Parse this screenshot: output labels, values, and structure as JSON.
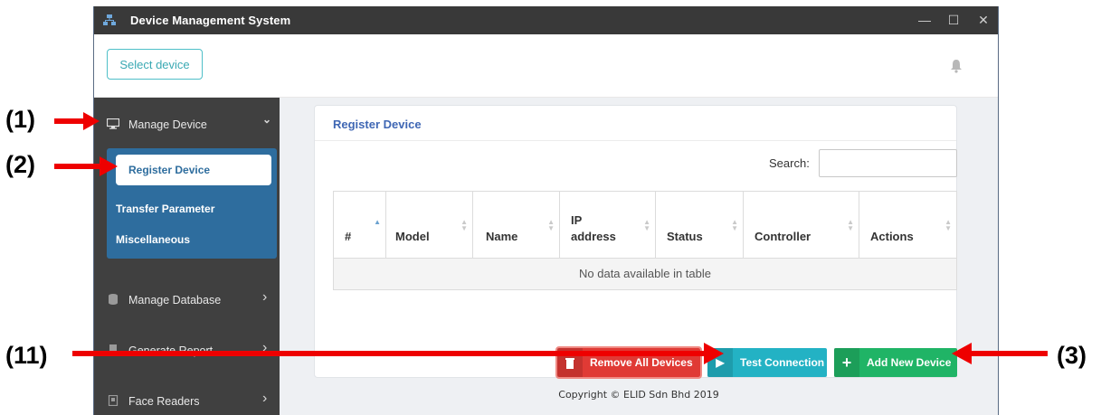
{
  "window": {
    "title": "Device Management System",
    "controls": {
      "minimize": "—",
      "maximize": "☐",
      "close": "✕"
    }
  },
  "header": {
    "select_device_label": "Select device"
  },
  "sidebar": {
    "items": [
      {
        "label": "Manage Device",
        "icon": "monitor-icon",
        "caret": "⌄"
      },
      {
        "label": "Manage Database",
        "icon": "database-icon",
        "caret": "›"
      },
      {
        "label": "Generate Report",
        "icon": "report-icon",
        "caret": "›"
      },
      {
        "label": "Face Readers",
        "icon": "face-reader-icon",
        "caret": "›"
      }
    ],
    "submenu": [
      {
        "label": "Register Device",
        "active": true
      },
      {
        "label": "Transfer Parameter"
      },
      {
        "label": "Miscellaneous"
      }
    ]
  },
  "main": {
    "card_title": "Register Device",
    "search_label": "Search:",
    "search_value": "",
    "table": {
      "columns": [
        "#",
        "Model",
        "Name",
        "IP address",
        "Status",
        "Controller",
        "Actions"
      ],
      "empty_text": "No data available in table"
    },
    "buttons": {
      "remove_all": "Remove All Devices",
      "test_connection": "Test Connection",
      "add_new": "Add New Device"
    },
    "copyright": "Copyright © ELID Sdn Bhd 2019"
  },
  "annotations": {
    "label_1": "(1)",
    "label_2": "(2)",
    "label_3": "(3)",
    "label_11": "(11)"
  },
  "colors": {
    "titlebar": "#393939",
    "sidebar": "#404040",
    "submenu": "#2e6d9e",
    "accent_teal": "#23b2c4",
    "danger": "#e03a35",
    "success": "#20b466",
    "arrow": "#ee0000"
  }
}
